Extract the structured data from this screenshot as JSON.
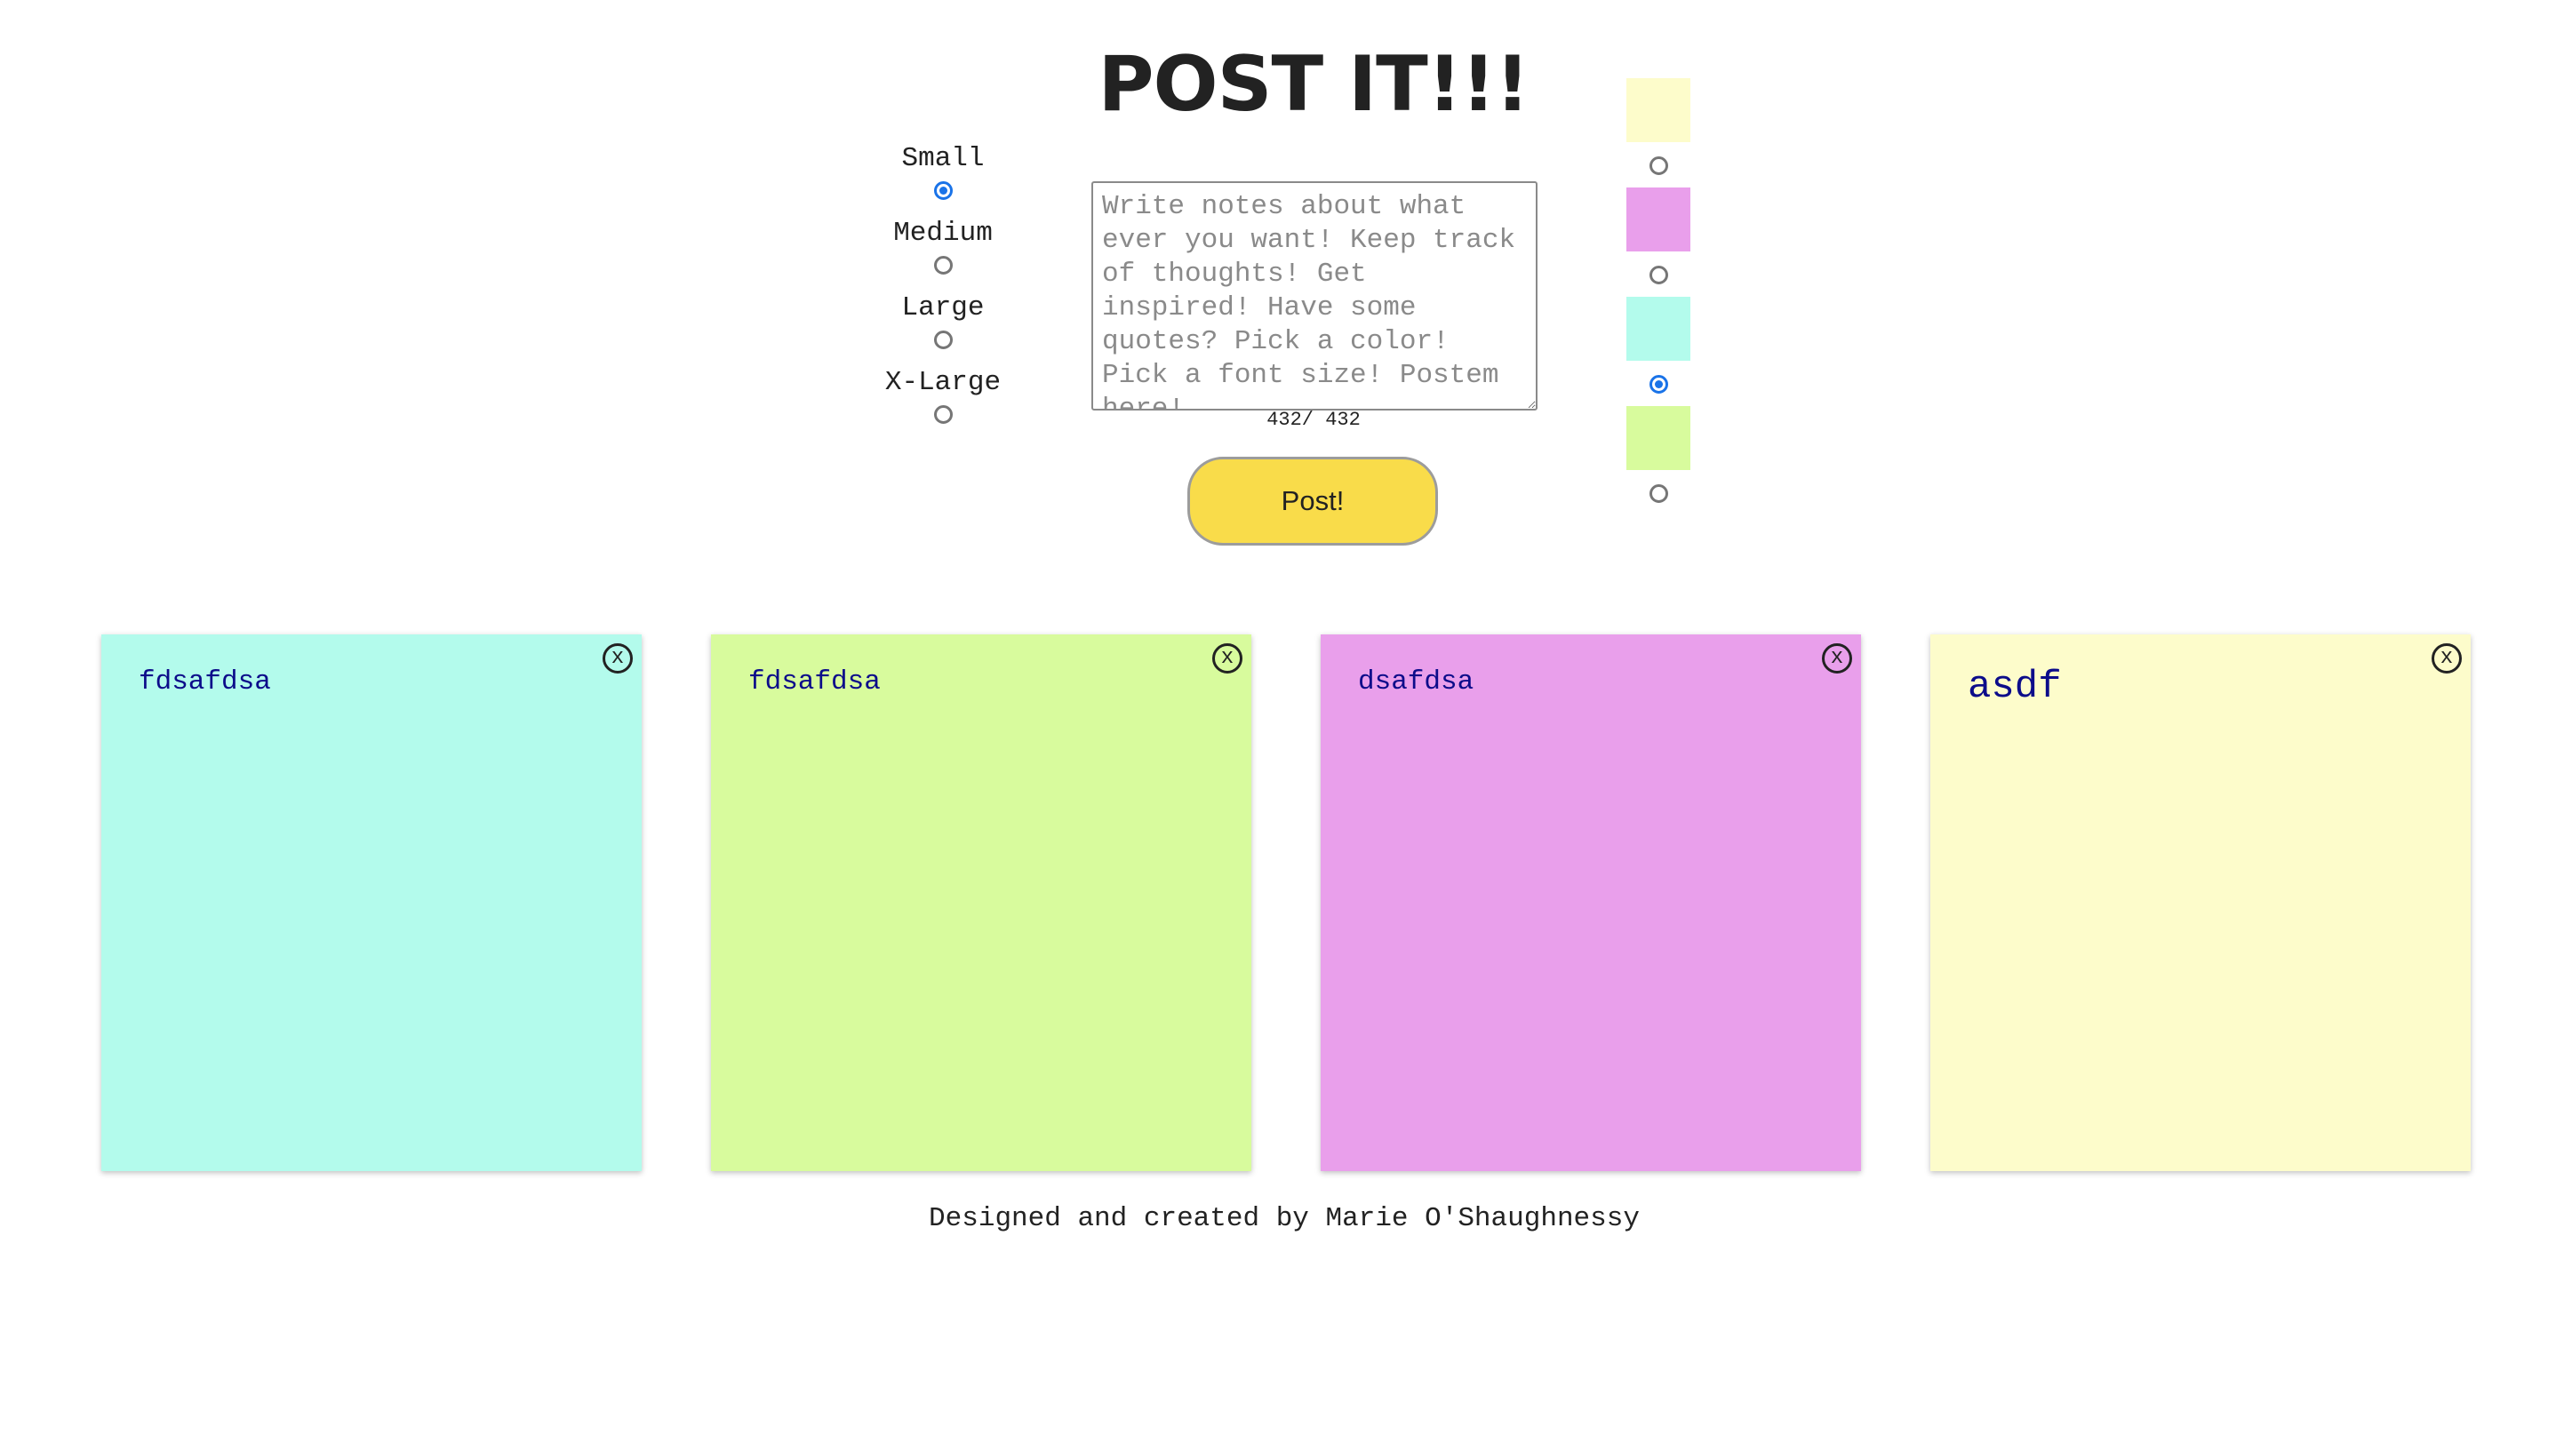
{
  "title": "POST IT!!!",
  "size_options": [
    {
      "label": "Small",
      "checked": true
    },
    {
      "label": "Medium",
      "checked": false
    },
    {
      "label": "Large",
      "checked": false
    },
    {
      "label": "X-Large",
      "checked": false
    }
  ],
  "note_input": {
    "placeholder": "Write notes about what ever you want! Keep track of thoughts! Get inspired! Have some quotes? Pick a color! Pick a font size! Postem here!",
    "value": ""
  },
  "counter": "432/ 432",
  "post_button_label": "Post!",
  "color_options": [
    {
      "color": "#fdfccb",
      "checked": false
    },
    {
      "color": "#e99feb",
      "checked": false
    },
    {
      "color": "#b3fbec",
      "checked": true
    },
    {
      "color": "#d8fb9d",
      "checked": false
    }
  ],
  "notes": [
    {
      "text": "fdsafdsa",
      "color": "#b3fbec",
      "size": "small"
    },
    {
      "text": "fdsafdsa",
      "color": "#d8fb9d",
      "size": "small"
    },
    {
      "text": "dsafdsa",
      "color": "#e99feb",
      "size": "small"
    },
    {
      "text": "asdf",
      "color": "#fdfccb",
      "size": "large"
    }
  ],
  "close_label": "x",
  "footer": "Designed and created by Marie O'Shaughnessy",
  "colors": {
    "note_text": "#0c0c8a",
    "radio_accent": "#1a73e8",
    "post_button": "#f9dc4a"
  }
}
